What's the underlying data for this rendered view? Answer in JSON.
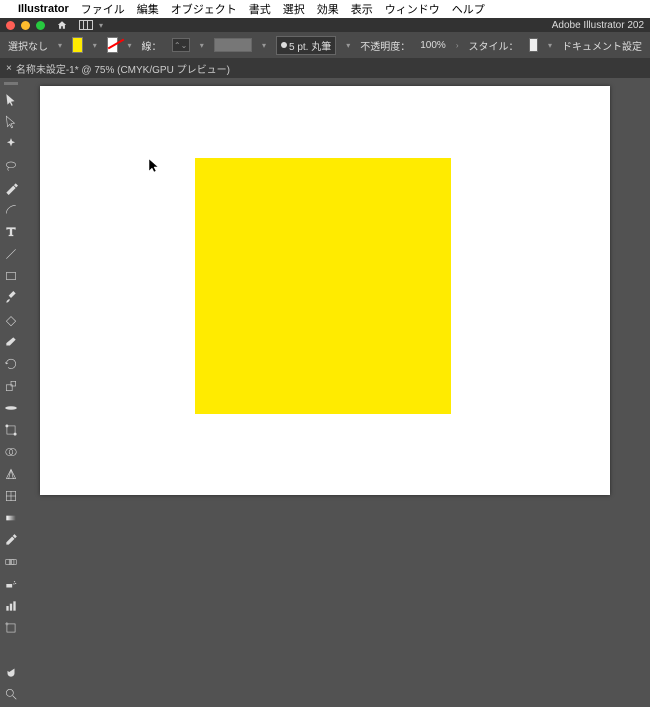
{
  "menubar": {
    "app_name": "Illustrator",
    "items": [
      "ファイル",
      "編集",
      "オブジェクト",
      "書式",
      "選択",
      "効果",
      "表示",
      "ウィンドウ",
      "ヘルプ"
    ]
  },
  "window_title": "Adobe Illustrator 202",
  "control_bar": {
    "no_selection": "選択なし",
    "stroke_label": "線：",
    "brush_label": "5 pt. 丸筆",
    "opacity_label": "不透明度：",
    "opacity_value": "100%",
    "style_label": "スタイル：",
    "doc_settings": "ドキュメント設定"
  },
  "tab": {
    "title": "名称未設定-1* @ 75% (CMYK/GPU プレビュー)"
  },
  "artwork": {
    "shape_color": "#ffeb00"
  }
}
